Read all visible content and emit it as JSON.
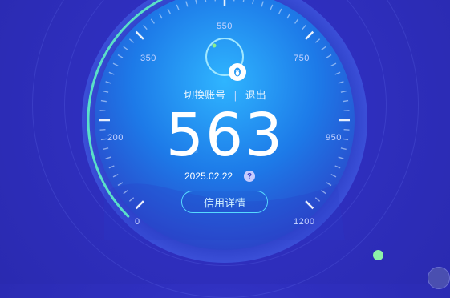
{
  "credit": {
    "score": "563",
    "date": "2025.02.22",
    "help_symbol": "?",
    "detail_button": "信用详情",
    "switch_account": "切换账号",
    "separator": "|",
    "logout": "退出",
    "range_min": 0,
    "range_max": 1200
  },
  "scale_labels": [
    "0",
    "200",
    "350",
    "550",
    "750",
    "950",
    "1200"
  ],
  "colors": {
    "background": "#2f2fbf",
    "gauge_inner": "#1e8ff0",
    "accent_cyan": "#57d9ff",
    "progress_arc": "#5ae0c8",
    "green_dot": "#8cf0a8"
  },
  "icons": {
    "avatar": "avatar-icon",
    "badge": "penguin-icon",
    "help": "help-icon",
    "status": "status-dot-icon",
    "corner": "corner-icon"
  }
}
